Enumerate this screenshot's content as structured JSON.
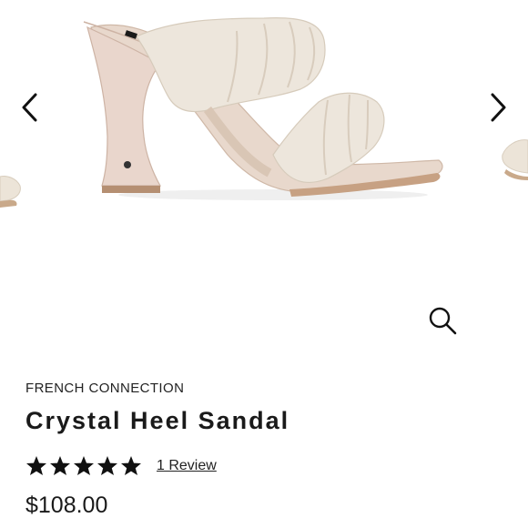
{
  "gallery": {
    "image_alt": "Cream leather ruched double-strap heel sandal",
    "prev_icon": "chevron-left-icon",
    "next_icon": "chevron-right-icon",
    "zoom_icon": "magnifier-icon",
    "colors": {
      "leather": "#ece4d8",
      "heel": "#e6d2c8",
      "sole_edge": "#c9a98a"
    }
  },
  "product": {
    "brand": "FRENCH CONNECTION",
    "name": "Crystal Heel Sandal",
    "rating": 5,
    "rating_max": 5,
    "reviews_label": "1 Review",
    "price": "$108.00"
  }
}
